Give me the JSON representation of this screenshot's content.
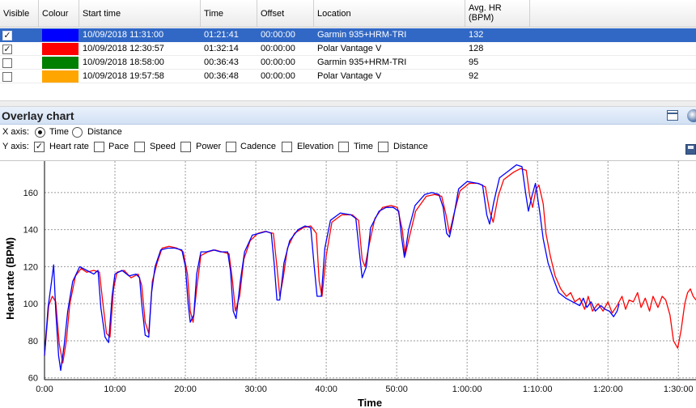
{
  "grid": {
    "columns": [
      "Visible",
      "Colour",
      "Start time",
      "Time",
      "Offset",
      "Location",
      "Avg. HR (BPM)"
    ],
    "avg_hr_header_line1": "Avg. HR",
    "avg_hr_header_line2": "(BPM)",
    "rows": [
      {
        "visible": true,
        "checkmark": "✓",
        "colour": "#0000ff",
        "start_time": "10/09/2018 11:31:00",
        "time": "01:21:41",
        "offset": "00:00:00",
        "location": "Garmin 935+HRM-TRI",
        "avg_hr": "132",
        "selected": true
      },
      {
        "visible": true,
        "checkmark": "✓",
        "colour": "#ff0000",
        "start_time": "10/09/2018 12:30:57",
        "time": "01:32:14",
        "offset": "00:00:00",
        "location": "Polar Vantage V",
        "avg_hr": "128",
        "selected": false
      },
      {
        "visible": false,
        "checkmark": "",
        "colour": "#008000",
        "start_time": "10/09/2018 18:58:00",
        "time": "00:36:43",
        "offset": "00:00:00",
        "location": "Garmin 935+HRM-TRI",
        "avg_hr": "95",
        "selected": false
      },
      {
        "visible": false,
        "checkmark": "",
        "colour": "#ffa500",
        "start_time": "10/09/2018 19:57:58",
        "time": "00:36:48",
        "offset": "00:00:00",
        "location": "Polar Vantage V",
        "avg_hr": "92",
        "selected": false
      }
    ]
  },
  "panel": {
    "title": "Overlay chart",
    "icons": [
      "maximize-icon",
      "close-icon",
      "save-icon"
    ]
  },
  "options": {
    "x_axis_label": "X axis:",
    "x_axis_choices": [
      {
        "label": "Time",
        "selected": true
      },
      {
        "label": "Distance",
        "selected": false
      }
    ],
    "y_axis_label": "Y axis:",
    "y_axis_choices": [
      {
        "label": "Heart rate",
        "checked": true,
        "checkmark": "✓"
      },
      {
        "label": "Pace",
        "checked": false,
        "checkmark": ""
      },
      {
        "label": "Speed",
        "checked": false,
        "checkmark": ""
      },
      {
        "label": "Power",
        "checked": false,
        "checkmark": ""
      },
      {
        "label": "Cadence",
        "checked": false,
        "checkmark": ""
      },
      {
        "label": "Elevation",
        "checked": false,
        "checkmark": ""
      },
      {
        "label": "Time",
        "checked": false,
        "checkmark": ""
      },
      {
        "label": "Distance",
        "checked": false,
        "checkmark": ""
      }
    ]
  },
  "chart_data": {
    "type": "line",
    "xlabel": "Time",
    "ylabel": "Heart rate (BPM)",
    "x_unit": "minutes",
    "xlim": [
      0,
      92.5
    ],
    "ylim": [
      59,
      177
    ],
    "grid": true,
    "x_tick_values": [
      0,
      10,
      20,
      30,
      40,
      50,
      60,
      70,
      80,
      90
    ],
    "x_ticks": [
      "0:00",
      "10:00",
      "20:00",
      "30:00",
      "40:00",
      "50:00",
      "1:00:00",
      "1:10:00",
      "1:20:00",
      "1:30:00"
    ],
    "y_ticks": [
      60,
      80,
      100,
      120,
      140,
      160
    ],
    "series": [
      {
        "color": "#0000ff",
        "points": [
          [
            0,
            72
          ],
          [
            0.5,
            98
          ],
          [
            1,
            112
          ],
          [
            1.3,
            121
          ],
          [
            1.6,
            96
          ],
          [
            2,
            72
          ],
          [
            2.3,
            64
          ],
          [
            2.8,
            78
          ],
          [
            3.3,
            96
          ],
          [
            4,
            112
          ],
          [
            5,
            120
          ],
          [
            6,
            118
          ],
          [
            7,
            116
          ],
          [
            7.6,
            118
          ],
          [
            8,
            98
          ],
          [
            8.6,
            82
          ],
          [
            9.1,
            79
          ],
          [
            9.6,
            104
          ],
          [
            10,
            116
          ],
          [
            11,
            118
          ],
          [
            12,
            115
          ],
          [
            13,
            116
          ],
          [
            13.5,
            114
          ],
          [
            13.8,
            100
          ],
          [
            14.3,
            83
          ],
          [
            14.8,
            82
          ],
          [
            15.2,
            106
          ],
          [
            15.7,
            120
          ],
          [
            16.5,
            129
          ],
          [
            17.5,
            130
          ],
          [
            18.5,
            130
          ],
          [
            19.5,
            129
          ],
          [
            20,
            120
          ],
          [
            20.4,
            100
          ],
          [
            20.7,
            90
          ],
          [
            21.2,
            94
          ],
          [
            21.6,
            116
          ],
          [
            22.2,
            128
          ],
          [
            23,
            128
          ],
          [
            24,
            129
          ],
          [
            25,
            128
          ],
          [
            26,
            128
          ],
          [
            26.4,
            118
          ],
          [
            26.8,
            96
          ],
          [
            27.2,
            92
          ],
          [
            27.8,
            112
          ],
          [
            28.4,
            128
          ],
          [
            29.5,
            137
          ],
          [
            30.5,
            138
          ],
          [
            31.5,
            139
          ],
          [
            32.2,
            138
          ],
          [
            32.6,
            122
          ],
          [
            33,
            102
          ],
          [
            33.4,
            102
          ],
          [
            34,
            122
          ],
          [
            34.8,
            134
          ],
          [
            36,
            140
          ],
          [
            37,
            142
          ],
          [
            37.8,
            141
          ],
          [
            38.3,
            120
          ],
          [
            38.7,
            104
          ],
          [
            39.3,
            104
          ],
          [
            39.8,
            130
          ],
          [
            40.6,
            145
          ],
          [
            42,
            149
          ],
          [
            43.5,
            148
          ],
          [
            44.2,
            146
          ],
          [
            44.7,
            128
          ],
          [
            45.1,
            114
          ],
          [
            45.7,
            120
          ],
          [
            46.3,
            141
          ],
          [
            47.5,
            150
          ],
          [
            48.5,
            152
          ],
          [
            49.5,
            152
          ],
          [
            50.3,
            150
          ],
          [
            50.7,
            136
          ],
          [
            51.1,
            125
          ],
          [
            51.7,
            140
          ],
          [
            52.6,
            153
          ],
          [
            54,
            159
          ],
          [
            55,
            160
          ],
          [
            56,
            159
          ],
          [
            56.6,
            152
          ],
          [
            57.1,
            138
          ],
          [
            57.5,
            136
          ],
          [
            58,
            145
          ],
          [
            58.8,
            162
          ],
          [
            60,
            166
          ],
          [
            61.5,
            165
          ],
          [
            62.2,
            164
          ],
          [
            62.8,
            148
          ],
          [
            63.2,
            143
          ],
          [
            63.8,
            155
          ],
          [
            64.6,
            168
          ],
          [
            66,
            172
          ],
          [
            67,
            175
          ],
          [
            67.8,
            174
          ],
          [
            68.3,
            160
          ],
          [
            68.7,
            150
          ],
          [
            69.2,
            158
          ],
          [
            69.7,
            165
          ],
          [
            70.3,
            150
          ],
          [
            70.8,
            135
          ],
          [
            71.5,
            122
          ],
          [
            72.3,
            113
          ],
          [
            73,
            106
          ],
          [
            74,
            103
          ],
          [
            75,
            101
          ],
          [
            76,
            99
          ],
          [
            76.5,
            103
          ],
          [
            77,
            98
          ],
          [
            77.6,
            101
          ],
          [
            78.2,
            96
          ],
          [
            79,
            99
          ],
          [
            79.6,
            97
          ],
          [
            80.2,
            96
          ],
          [
            80.8,
            93
          ],
          [
            81.3,
            96
          ],
          [
            81.6,
            100
          ]
        ]
      },
      {
        "color": "#ff0000",
        "points": [
          [
            0,
            72
          ],
          [
            0.6,
            99
          ],
          [
            1.1,
            104
          ],
          [
            1.6,
            101
          ],
          [
            2.1,
            78
          ],
          [
            2.6,
            68
          ],
          [
            3.1,
            80
          ],
          [
            3.6,
            100
          ],
          [
            4.4,
            115
          ],
          [
            5.2,
            119
          ],
          [
            6,
            117
          ],
          [
            7,
            118
          ],
          [
            7.8,
            117
          ],
          [
            8.3,
            100
          ],
          [
            8.8,
            84
          ],
          [
            9.3,
            82
          ],
          [
            9.8,
            108
          ],
          [
            10.3,
            117
          ],
          [
            11.3,
            118
          ],
          [
            12.3,
            114
          ],
          [
            13.3,
            116
          ],
          [
            13.8,
            110
          ],
          [
            14.3,
            90
          ],
          [
            14.8,
            84
          ],
          [
            15.3,
            112
          ],
          [
            16,
            122
          ],
          [
            16.7,
            130
          ],
          [
            17.7,
            131
          ],
          [
            18.8,
            130
          ],
          [
            19.7,
            128
          ],
          [
            20.3,
            116
          ],
          [
            20.7,
            96
          ],
          [
            21.1,
            90
          ],
          [
            21.6,
            108
          ],
          [
            22.2,
            126
          ],
          [
            23.2,
            128
          ],
          [
            24.2,
            129
          ],
          [
            25.2,
            128
          ],
          [
            26.2,
            127
          ],
          [
            26.7,
            112
          ],
          [
            27.1,
            96
          ],
          [
            27.7,
            104
          ],
          [
            28.3,
            124
          ],
          [
            29.2,
            134
          ],
          [
            30.3,
            138
          ],
          [
            31.3,
            139
          ],
          [
            32.5,
            138
          ],
          [
            33,
            120
          ],
          [
            33.4,
            104
          ],
          [
            33.9,
            114
          ],
          [
            34.5,
            130
          ],
          [
            35.5,
            138
          ],
          [
            36.7,
            141
          ],
          [
            37.8,
            142
          ],
          [
            38.6,
            138
          ],
          [
            39,
            112
          ],
          [
            39.4,
            104
          ],
          [
            40,
            126
          ],
          [
            40.8,
            144
          ],
          [
            42.2,
            148
          ],
          [
            43.7,
            148
          ],
          [
            44.6,
            145
          ],
          [
            45.1,
            124
          ],
          [
            45.5,
            120
          ],
          [
            46.1,
            132
          ],
          [
            46.9,
            146
          ],
          [
            48,
            152
          ],
          [
            49.2,
            153
          ],
          [
            50.1,
            152
          ],
          [
            50.8,
            140
          ],
          [
            51.2,
            126
          ],
          [
            51.8,
            136
          ],
          [
            52.7,
            150
          ],
          [
            54.2,
            158
          ],
          [
            55.4,
            159
          ],
          [
            56.4,
            158
          ],
          [
            57,
            148
          ],
          [
            57.5,
            138
          ],
          [
            58.1,
            148
          ],
          [
            59,
            161
          ],
          [
            60.3,
            165
          ],
          [
            61.6,
            165
          ],
          [
            62.6,
            163
          ],
          [
            63.2,
            150
          ],
          [
            63.7,
            144
          ],
          [
            64.4,
            158
          ],
          [
            65.2,
            167
          ],
          [
            66.6,
            171
          ],
          [
            67.6,
            173
          ],
          [
            68.4,
            172
          ],
          [
            68.9,
            158
          ],
          [
            69.3,
            152
          ],
          [
            69.8,
            162
          ],
          [
            70.2,
            164
          ],
          [
            70.8,
            154
          ],
          [
            71.2,
            138
          ],
          [
            71.8,
            126
          ],
          [
            72.5,
            115
          ],
          [
            73.3,
            108
          ],
          [
            74.1,
            104
          ],
          [
            74.7,
            106
          ],
          [
            75.3,
            101
          ],
          [
            76,
            103
          ],
          [
            76.7,
            97
          ],
          [
            77.2,
            104
          ],
          [
            77.8,
            96
          ],
          [
            78.6,
            100
          ],
          [
            79.3,
            96
          ],
          [
            80,
            101
          ],
          [
            80.6,
            95
          ],
          [
            81.3,
            99
          ],
          [
            82,
            104
          ],
          [
            82.5,
            97
          ],
          [
            83,
            102
          ],
          [
            83.6,
            101
          ],
          [
            84.2,
            106
          ],
          [
            84.7,
            98
          ],
          [
            85.3,
            103
          ],
          [
            85.9,
            96
          ],
          [
            86.4,
            104
          ],
          [
            87.1,
            98
          ],
          [
            87.7,
            104
          ],
          [
            88.2,
            102
          ],
          [
            88.8,
            94
          ],
          [
            89.3,
            80
          ],
          [
            89.9,
            76
          ],
          [
            90.4,
            86
          ],
          [
            90.9,
            100
          ],
          [
            91.3,
            106
          ],
          [
            91.7,
            108
          ],
          [
            92.1,
            104
          ],
          [
            92.5,
            102
          ]
        ]
      }
    ]
  }
}
